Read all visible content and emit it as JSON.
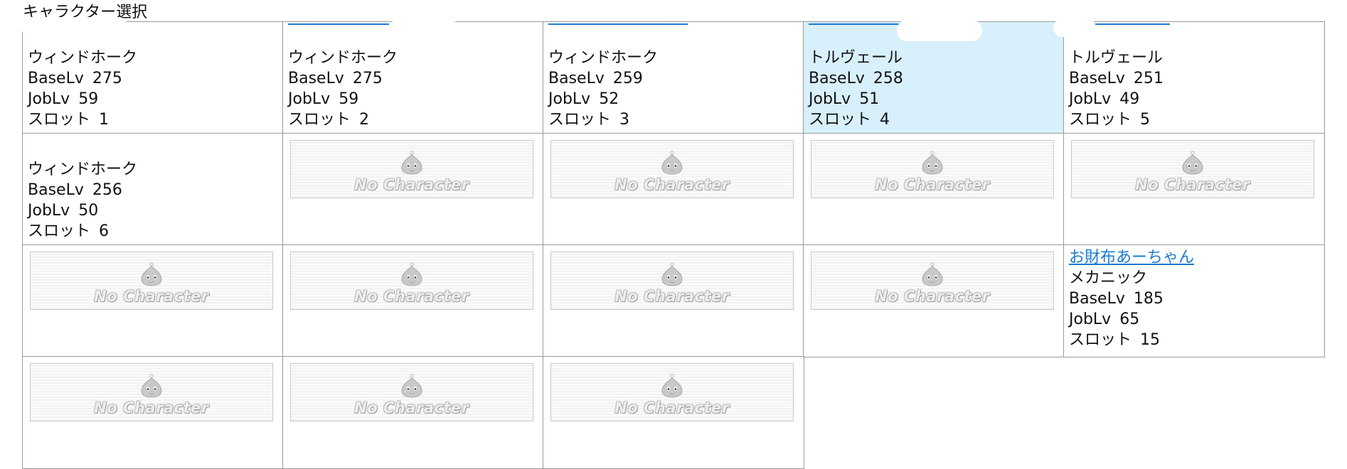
{
  "page_title": "キャラクター選択",
  "labels": {
    "base": "BaseLv",
    "job": "JobLv",
    "slot": "スロット"
  },
  "no_character_text": "No Character",
  "cells": [
    {
      "name": "",
      "job": "ウィンドホーク",
      "base_lv": "275",
      "job_lv": "59",
      "slot": "1"
    },
    {
      "name": "",
      "job": "ウィンドホーク",
      "base_lv": "275",
      "job_lv": "59",
      "slot": "2"
    },
    {
      "name": "",
      "job": "ウィンドホーク",
      "base_lv": "259",
      "job_lv": "52",
      "slot": "3"
    },
    {
      "name": "",
      "job": "トルヴェール",
      "base_lv": "258",
      "job_lv": "51",
      "slot": "4",
      "selected": true
    },
    {
      "name": "",
      "job": "トルヴェール",
      "base_lv": "251",
      "job_lv": "49",
      "slot": "5"
    },
    {
      "name": "",
      "job": "ウィンドホーク",
      "base_lv": "256",
      "job_lv": "50",
      "slot": "6"
    },
    {
      "name": "お財布あーちゃん",
      "job": "メカニック",
      "base_lv": "185",
      "job_lv": "65",
      "slot": "15"
    }
  ],
  "colors": {
    "link": "#1a7bd0",
    "selected_bg": "#d8f0fb",
    "border": "#9a9a9a"
  }
}
